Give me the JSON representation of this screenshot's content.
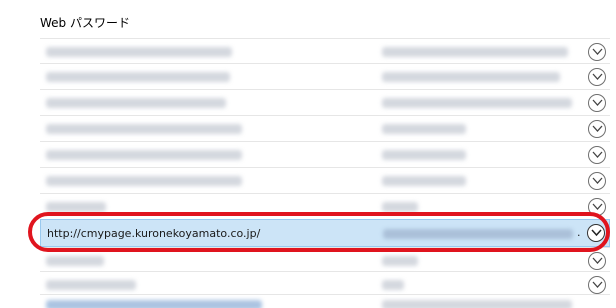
{
  "section": {
    "title": "Web パスワード"
  },
  "rows": [
    {
      "kind": "blurred"
    },
    {
      "kind": "blurred"
    },
    {
      "kind": "blurred"
    },
    {
      "kind": "blurred"
    },
    {
      "kind": "blurred"
    },
    {
      "kind": "blurred"
    },
    {
      "kind": "blurred"
    },
    {
      "kind": "selected",
      "url": "http://cmypage.kuronekoyamato.co.jp/",
      "user_suffix": "."
    },
    {
      "kind": "blurred"
    },
    {
      "kind": "blurred"
    }
  ],
  "colors": {
    "selection_bg": "#cce4f7",
    "highlight_ring": "#e0141e"
  },
  "icons": {
    "expand": "chevron-down-circle-icon"
  }
}
